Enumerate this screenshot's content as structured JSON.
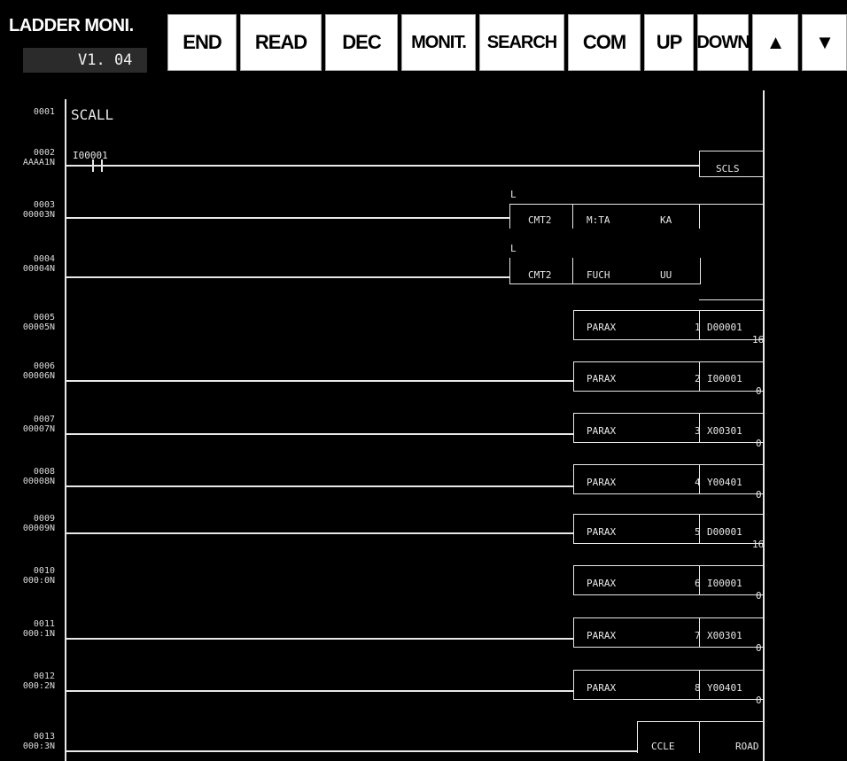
{
  "toolbar": {
    "title": "LADDER MONI.",
    "version": "V1. 04",
    "buttons": [
      {
        "id": "end",
        "label": "END"
      },
      {
        "id": "read",
        "label": "READ"
      },
      {
        "id": "dec",
        "label": "DEC"
      },
      {
        "id": "monit",
        "label": "MONIT."
      },
      {
        "id": "search",
        "label": "SEARCH"
      },
      {
        "id": "com",
        "label": "COM"
      },
      {
        "id": "up",
        "label": "UP"
      },
      {
        "id": "down",
        "label": "DOWN"
      },
      {
        "id": "scroll_up",
        "label": "▲"
      },
      {
        "id": "scroll_down",
        "label": "▼"
      }
    ]
  },
  "ladder": {
    "r1": {
      "step": "0001",
      "addr": "",
      "comment": "SCALL"
    },
    "r2": {
      "step": "0002",
      "addr": "AAAA1N",
      "contact": "I00001",
      "coil": "SCLS"
    },
    "r3": {
      "step": "0003",
      "addr": "00003N",
      "marker": "L",
      "cmd": "CMT2",
      "arg1": "M:TA",
      "arg2": "KA"
    },
    "r4": {
      "step": "0004",
      "addr": "00004N",
      "marker": "L",
      "cmd": "CMT2",
      "arg1": "FUCH",
      "arg2": "UU"
    },
    "r5": {
      "step": "0005",
      "addr": "00005N",
      "cmd": "PARAX",
      "idx": "1",
      "dev": "D00001",
      "val": "16"
    },
    "r6": {
      "step": "0006",
      "addr": "00006N",
      "cmd": "PARAX",
      "idx": "2",
      "dev": "I00001",
      "val": "0"
    },
    "r7": {
      "step": "0007",
      "addr": "00007N",
      "cmd": "PARAX",
      "idx": "3",
      "dev": "X00301",
      "val": "0"
    },
    "r8": {
      "step": "0008",
      "addr": "00008N",
      "cmd": "PARAX",
      "idx": "4",
      "dev": "Y00401",
      "val": "0"
    },
    "r9": {
      "step": "0009",
      "addr": "00009N",
      "cmd": "PARAX",
      "idx": "5",
      "dev": "D00001",
      "val": "16"
    },
    "r10": {
      "step": "0010",
      "addr": "000:0N",
      "cmd": "PARAX",
      "idx": "6",
      "dev": "I00001",
      "val": "0"
    },
    "r11": {
      "step": "0011",
      "addr": "000:1N",
      "cmd": "PARAX",
      "idx": "7",
      "dev": "X00301",
      "val": "0"
    },
    "r12": {
      "step": "0012",
      "addr": "000:2N",
      "cmd": "PARAX",
      "idx": "8",
      "dev": "Y00401",
      "val": "0"
    },
    "r13": {
      "step": "0013",
      "addr": "000:3N",
      "cmd": "CCLE",
      "dev": "ROAD"
    }
  },
  "colors": {
    "background": "#000000",
    "wire": "#e8e8e8",
    "button": "#ffffff"
  }
}
